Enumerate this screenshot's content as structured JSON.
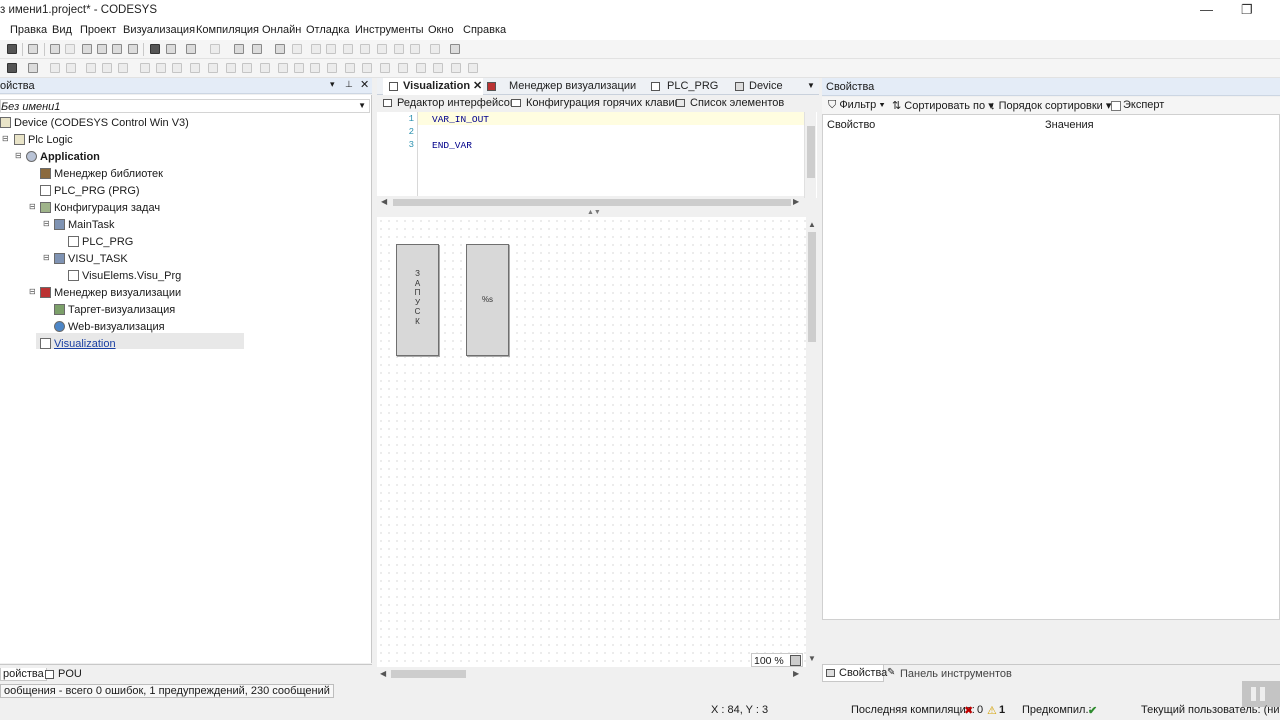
{
  "window": {
    "title": "з имени1.project* - CODESYS",
    "minimize": "—",
    "restore": "❐"
  },
  "menu": [
    "Правка",
    "Вид",
    "Проект",
    "Визуализация",
    "Компиляция",
    "Онлайн",
    "Отладка",
    "Инструменты",
    "Окно",
    "Справка"
  ],
  "left_panel": {
    "title": "ойства",
    "project": "Без имени1",
    "tree": [
      {
        "label": "Device (CODESYS Control Win V3)",
        "icon": "device-icon"
      },
      {
        "label": "Plc Logic",
        "icon": "plc-logic-icon"
      },
      {
        "label": "Application",
        "icon": "application-icon"
      },
      {
        "label": "Менеджер библиотек",
        "icon": "library-manager-icon"
      },
      {
        "label": "PLC_PRG (PRG)",
        "icon": "pou-icon"
      },
      {
        "label": "Конфигурация задач",
        "icon": "task-config-icon"
      },
      {
        "label": "MainTask",
        "icon": "task-icon"
      },
      {
        "label": "PLC_PRG",
        "icon": "pou-call-icon"
      },
      {
        "label": "VISU_TASK",
        "icon": "task-icon"
      },
      {
        "label": "VisuElems.Visu_Prg",
        "icon": "pou-call-icon"
      },
      {
        "label": "Менеджер визуализации",
        "icon": "visu-manager-icon"
      },
      {
        "label": "Таргет-визуализация",
        "icon": "target-visu-icon"
      },
      {
        "label": "Web-визуализация",
        "icon": "web-visu-icon"
      },
      {
        "label": "Visualization",
        "icon": "visualization-icon"
      }
    ],
    "bottom_tabs": [
      "ройства",
      "POU"
    ]
  },
  "editor": {
    "tabs": [
      "Visualization",
      "Менеджер визуализации",
      "PLC_PRG",
      "Device"
    ],
    "subtabs": [
      "Редактор интерфейсов",
      "Конфигурация горячих клавиш",
      "Список элементов"
    ],
    "code_lines": [
      {
        "n": "1",
        "text": "VAR_IN_OUT"
      },
      {
        "n": "2",
        "text": ""
      },
      {
        "n": "3",
        "text": "END_VAR"
      }
    ],
    "button1_letters": [
      "З",
      "А",
      "П",
      "У",
      "С",
      "К"
    ],
    "button2_text": "%s",
    "zoom": "100 %"
  },
  "properties": {
    "title": "Свойства",
    "toolbar": {
      "filter": "Фильтр",
      "sort_by": "Сортировать по",
      "sort_order": "Порядок сортировки",
      "expert": "Эксперт"
    },
    "columns": {
      "property": "Свойство",
      "value": "Значения"
    },
    "bottom_tabs": [
      "Свойства",
      "Панель инструментов"
    ]
  },
  "messages": "ообщения - всего 0 ошибок, 1 предупреждений, 230 сообщений",
  "status": {
    "coords": "X : 84, Y : 3",
    "last_compile_label": "Последняя компиляция:",
    "errors": "0",
    "warnings": "1",
    "precompile_label": "Предкомпил.:",
    "precompile_ok": "✔",
    "user": "Текущий пользователь: (никто)"
  },
  "colors": {
    "link": "#1a3fa3",
    "keyword": "#00008b",
    "line_numbers": "#2b91af",
    "panel_header": "#e4ecf7",
    "error": "#c00000",
    "warning": "#d4a000",
    "ok": "#2e8b2e"
  }
}
